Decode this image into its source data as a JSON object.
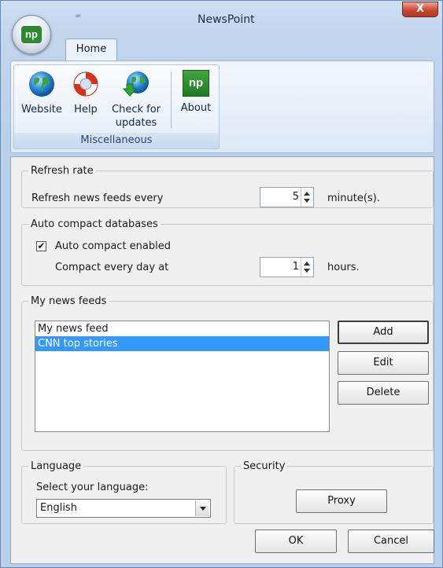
{
  "window": {
    "title": "NewsPoint",
    "close_symbol": "X"
  },
  "app_menu": {
    "logo_text": "np",
    "qat_symbol": "="
  },
  "ribbon": {
    "tabs": [
      {
        "label": "Home"
      }
    ],
    "group_label": "Miscellaneous",
    "buttons": {
      "website": "Website",
      "help": "Help",
      "check_line1": "Check for",
      "check_line2": "updates",
      "about": "About",
      "about_icon_text": "np"
    }
  },
  "refresh": {
    "legend": "Refresh rate",
    "label": "Refresh news feeds every",
    "value": "5",
    "unit": "minute(s)."
  },
  "compact": {
    "legend": "Auto compact databases",
    "checkbox_label": "Auto compact enabled",
    "checked_mark": "✔",
    "label": "Compact every day at",
    "value": "1",
    "unit": "hours."
  },
  "feeds": {
    "legend": "My news feeds",
    "items": [
      {
        "label": "My news feed",
        "selected": false
      },
      {
        "label": "CNN top stories",
        "selected": true
      }
    ],
    "add_label": "Add",
    "edit_label": "Edit",
    "delete_label": "Delete"
  },
  "language": {
    "legend": "Language",
    "label": "Select your language:",
    "selected": "English"
  },
  "security": {
    "legend": "Security",
    "proxy_label": "Proxy"
  },
  "footer": {
    "ok_label": "OK",
    "cancel_label": "Cancel"
  },
  "colors": {
    "accent": "#3399ff",
    "logo_green": "#2f8a2f",
    "close_red": "#c4442b"
  }
}
